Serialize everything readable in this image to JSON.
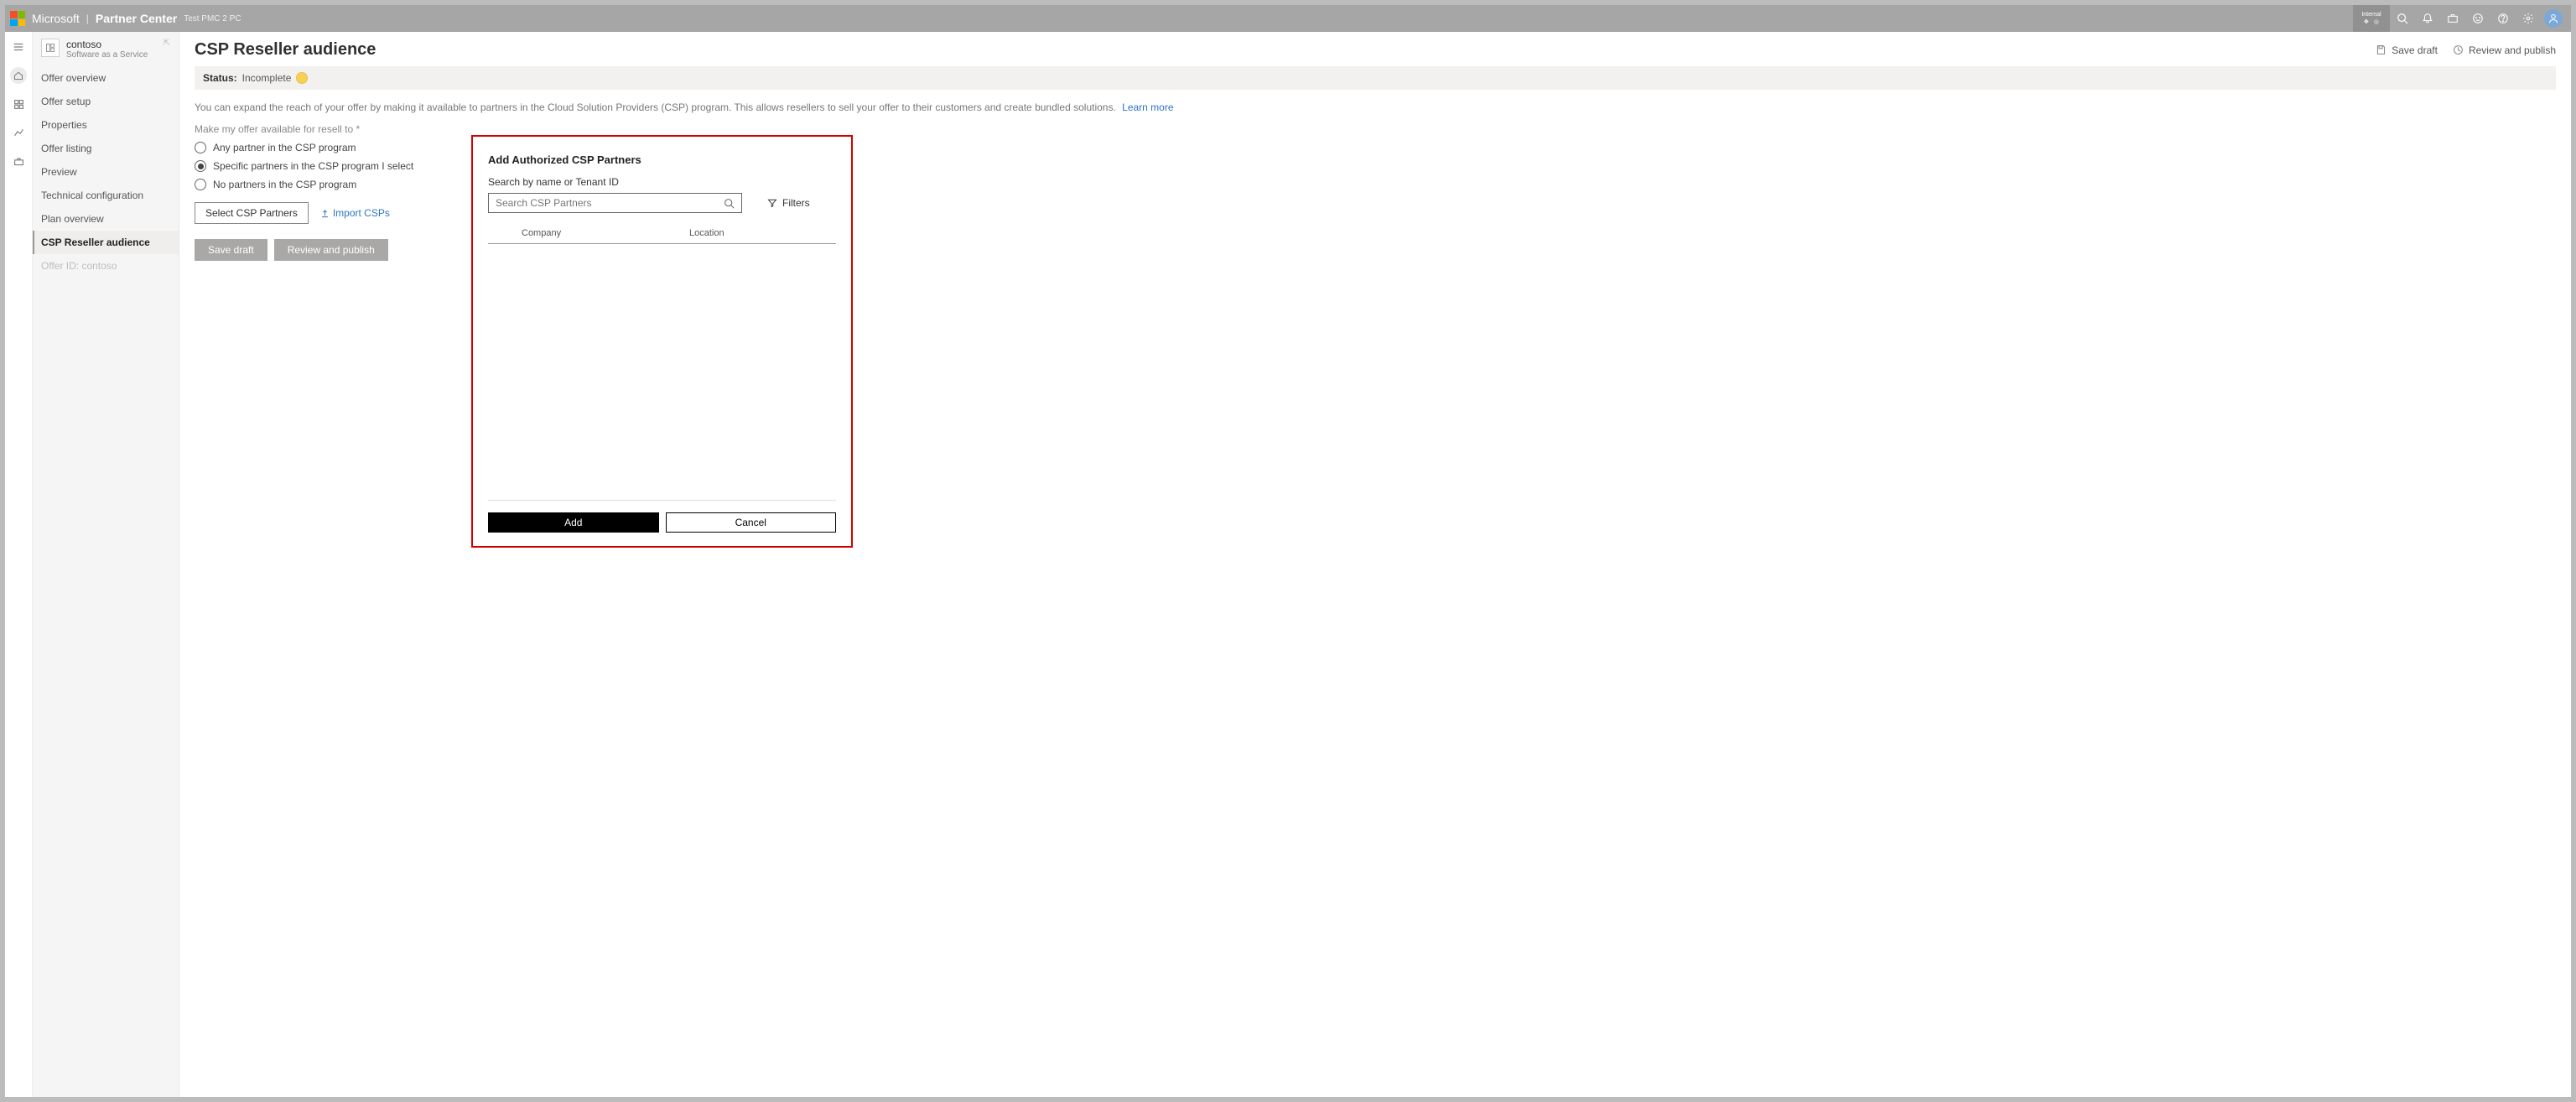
{
  "topbar": {
    "brand": "Microsoft",
    "product": "Partner Center",
    "env": "Test PMC 2 PC",
    "badge_label": "Internal"
  },
  "offer": {
    "name": "contoso",
    "subtitle": "Software as a Service"
  },
  "nav": {
    "items": [
      {
        "label": "Offer overview"
      },
      {
        "label": "Offer setup"
      },
      {
        "label": "Properties"
      },
      {
        "label": "Offer listing"
      },
      {
        "label": "Preview"
      },
      {
        "label": "Technical configuration"
      },
      {
        "label": "Plan overview"
      },
      {
        "label": "CSP Reseller audience"
      },
      {
        "label": "Offer ID: contoso"
      }
    ]
  },
  "page": {
    "title": "CSP Reseller audience",
    "save_draft": "Save draft",
    "review_publish": "Review and publish"
  },
  "status": {
    "label": "Status:",
    "value": "Incomplete"
  },
  "description": "You can expand the reach of your offer by making it available to partners in the Cloud Solution Providers (CSP) program. This allows resellers to sell your offer to their customers and create bundled solutions.",
  "learn_more": "Learn more",
  "resell": {
    "label": "Make my offer available for resell to *",
    "options": [
      "Any partner in the CSP program",
      "Specific partners in the CSP program I select",
      "No partners in the CSP program"
    ],
    "selected_index": 1,
    "select_btn": "Select CSP Partners",
    "import_link": "Import CSPs"
  },
  "footer_buttons": {
    "save": "Save draft",
    "review": "Review and publish"
  },
  "modal": {
    "title": "Add Authorized CSP Partners",
    "search_label": "Search by name or Tenant ID",
    "search_placeholder": "Search CSP Partners",
    "filters": "Filters",
    "col_company": "Company",
    "col_location": "Location",
    "add": "Add",
    "cancel": "Cancel"
  }
}
